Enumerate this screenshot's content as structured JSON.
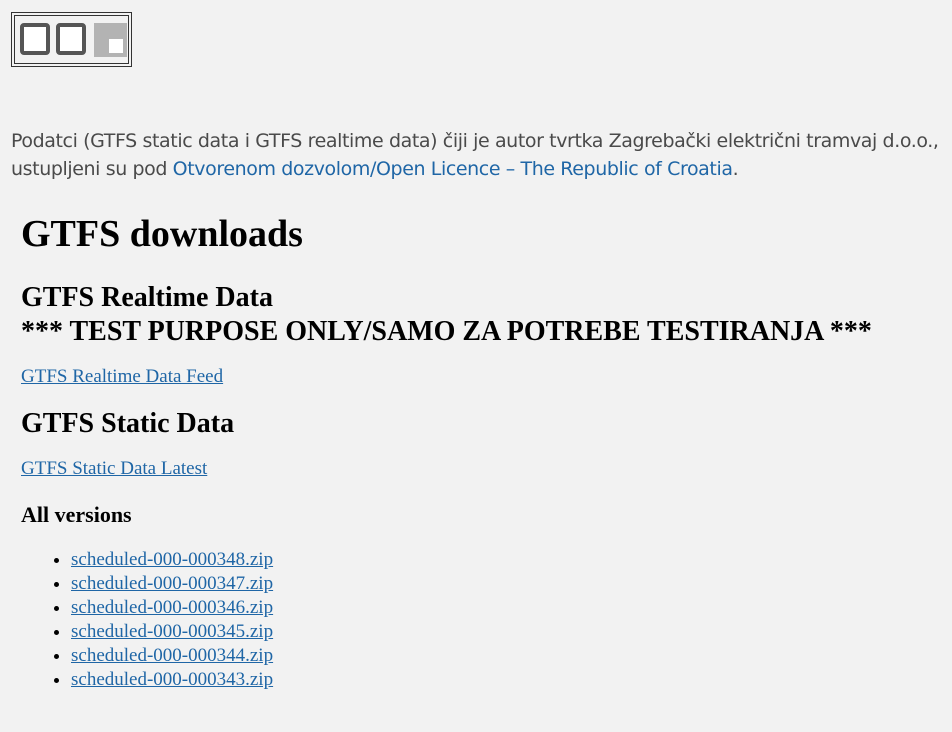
{
  "logo": {
    "icon": "gtfs-logo-icon"
  },
  "licence": {
    "text": "Podatci (GTFS static data i GTFS realtime data) čiji je autor tvrtka Zagrebački električni tramvaj d.o.o., ustupljeni su pod ",
    "link_label": "Otvorenom dozvolom/Open Licence – The Republic of Croatia",
    "suffix": "."
  },
  "main": {
    "title": "GTFS downloads",
    "realtime": {
      "heading": "GTFS Realtime Data",
      "notice": "*** TEST PURPOSE ONLY/SAMO ZA POTREBE TESTIRANJA ***",
      "feed_link": "GTFS Realtime Data Feed"
    },
    "static": {
      "heading": "GTFS Static Data",
      "latest_link": "GTFS Static Data Latest",
      "versions_heading": "All versions",
      "versions": [
        "scheduled-000-000348.zip",
        "scheduled-000-000347.zip",
        "scheduled-000-000346.zip",
        "scheduled-000-000345.zip",
        "scheduled-000-000344.zip",
        "scheduled-000-000343.zip"
      ]
    }
  },
  "colors": {
    "background": "#f2f2f2",
    "link": "#1f66a6",
    "body_text": "#4a4a4a"
  }
}
